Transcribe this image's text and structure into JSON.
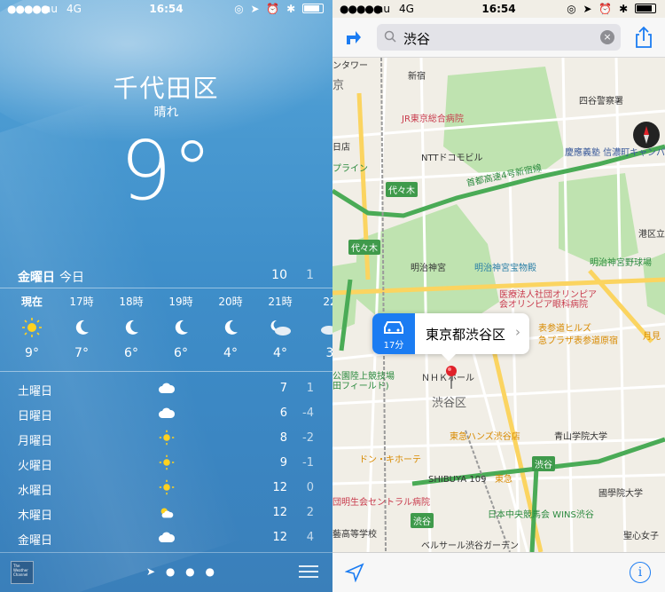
{
  "weather": {
    "status_bar": {
      "signal": "●●●●●",
      "carrier": "au",
      "network": "4G",
      "time": "16:54",
      "icons": "◎ ➤ ⏰ ✱"
    },
    "city": "千代田区",
    "condition": "晴れ",
    "current_temp": "9°",
    "today": {
      "day": "金曜日",
      "label": "今日",
      "high": "10",
      "low": "1"
    },
    "hourly": [
      {
        "time": "現在",
        "icon": "sun-icon",
        "temp": "9°",
        "bold": true
      },
      {
        "time": "17時",
        "icon": "moon-icon",
        "temp": "7°"
      },
      {
        "time": "18時",
        "icon": "moon-icon",
        "temp": "6°"
      },
      {
        "time": "19時",
        "icon": "moon-icon",
        "temp": "6°"
      },
      {
        "time": "20時",
        "icon": "moon-icon",
        "temp": "4°"
      },
      {
        "time": "21時",
        "icon": "cloudy-night-icon",
        "temp": "4°"
      },
      {
        "time": "22",
        "icon": "cloudy-night-icon",
        "temp": "3"
      }
    ],
    "daily": [
      {
        "day": "土曜日",
        "icon": "cloud-icon",
        "high": "7",
        "low": "1"
      },
      {
        "day": "日曜日",
        "icon": "cloud-icon",
        "high": "6",
        "low": "-4"
      },
      {
        "day": "月曜日",
        "icon": "sun-icon",
        "high": "8",
        "low": "-2"
      },
      {
        "day": "火曜日",
        "icon": "sun-icon",
        "high": "9",
        "low": "-1"
      },
      {
        "day": "水曜日",
        "icon": "sun-icon",
        "high": "12",
        "low": "0"
      },
      {
        "day": "木曜日",
        "icon": "partly-cloudy-icon",
        "high": "12",
        "low": "2"
      },
      {
        "day": "金曜日",
        "icon": "cloud-icon",
        "high": "12",
        "low": "4"
      }
    ],
    "footer": {
      "logo_text": "The Weather Channel",
      "pager": "➤ ● ● ●"
    }
  },
  "maps": {
    "status_bar": {
      "signal": "●●●●●",
      "carrier": "au",
      "network": "4G",
      "time": "16:54",
      "icons": "◎ ➤ ⏰ ✱"
    },
    "search": {
      "query": "渋谷",
      "clear": "×"
    },
    "callout": {
      "eta": "17分",
      "name": "東京都渋谷区",
      "chevron": "›"
    },
    "labels": {
      "tower": "ンタワー",
      "kyo": "京",
      "shinjuku_station": "新宿",
      "jr_hospital": "JR東京総合病院",
      "ten": "日店",
      "docomo": "NTTドコモビル",
      "yotsuya_police": "四谷警察署",
      "keio": "慶應義塾 信濃町キャンパス",
      "pline": "プライン",
      "expressway": "首都高速4号新宿線",
      "yoyogi_hw": "代々木",
      "yoyogi_hw2": "代々木",
      "minato": "港区立青",
      "meiji": "明治神宮",
      "meiji_museum": "明治神宮宝物殿",
      "meiji_stadium": "明治神宮野球場",
      "olympia_hospital": "医療法人社団オリンピア 会オリンピア眼科病院",
      "omotesando": "表参道ヒルズ",
      "omotesando_plaza": "急プラザ表参道原宿",
      "tsuki": "月見",
      "nhk": "ＮＨＫホール",
      "stadium": "公園陸上競技場 田フィールド)",
      "shibuya_ward": "渋谷区",
      "hands": "東急ハンズ渋谷店",
      "aoyama_univ": "青山学院大学",
      "donki": "ドン・キホーテ",
      "shibuya109": "SHIBUYA 109",
      "shibuya_hw": "渋谷",
      "kokugakuin": "國學院大学",
      "tokyu": "東急",
      "hospital2": "団明生会セントラル病院",
      "wins": "日本中央競馬会 WINS渋谷",
      "high_school": "藝高等学校",
      "bellesalle": "ベルサール渋谷ガーデン",
      "seishin": "聖心女子",
      "shibuya_hw2": "渋谷"
    }
  }
}
